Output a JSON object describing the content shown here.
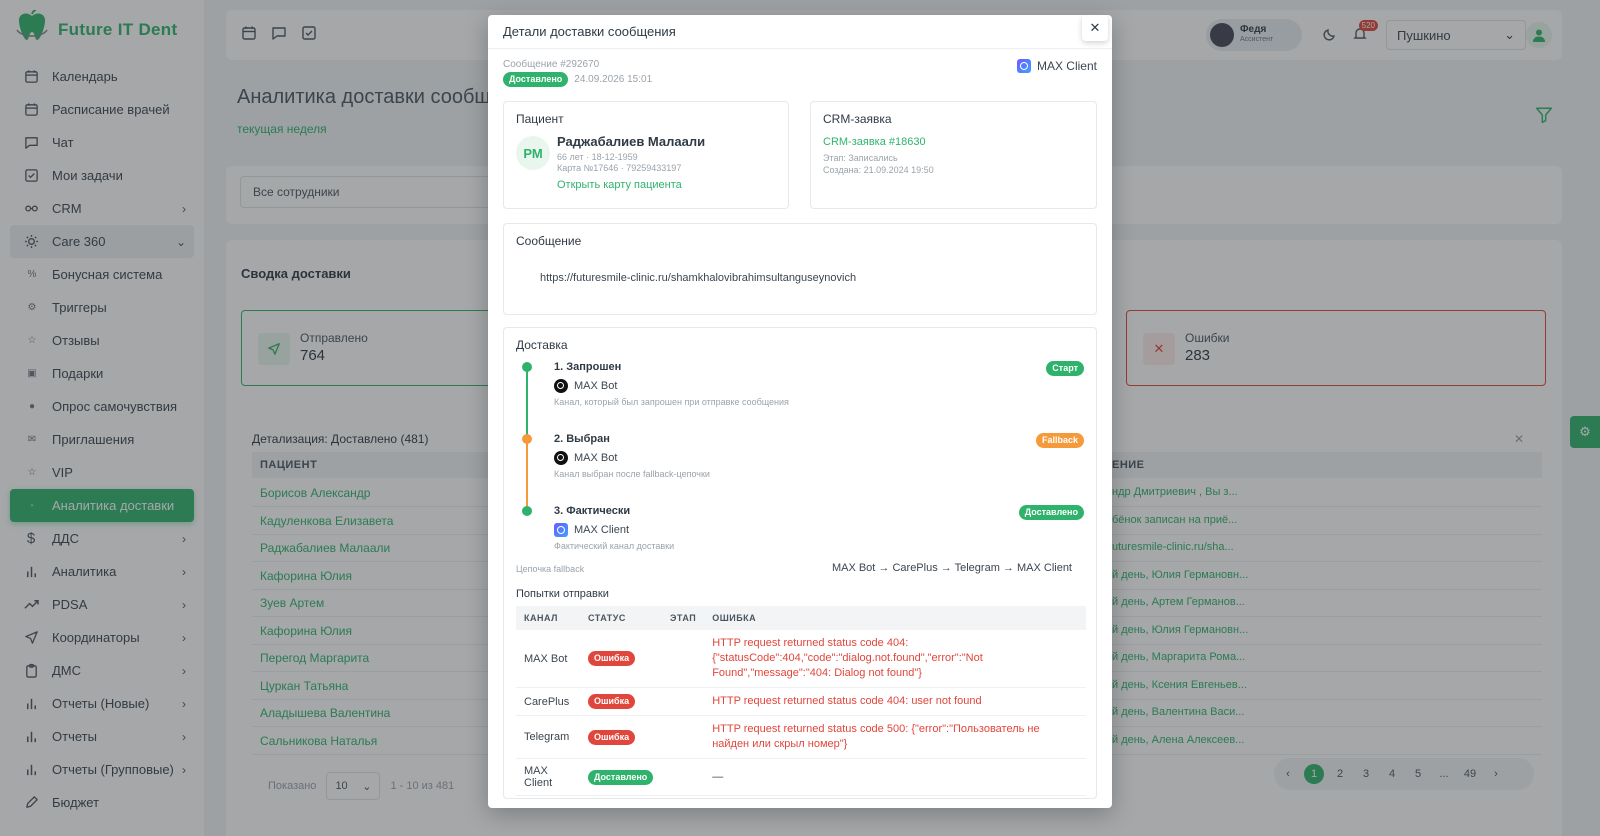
{
  "app": {
    "name": "Future IT Dent"
  },
  "sidebar": {
    "items": [
      {
        "label": "Календарь"
      },
      {
        "label": "Расписание врачей"
      },
      {
        "label": "Чат"
      },
      {
        "label": "Мои задачи"
      },
      {
        "label": "CRM"
      },
      {
        "label": "Care 360"
      },
      {
        "label": "Бонусная система"
      },
      {
        "label": "Триггеры"
      },
      {
        "label": "Отзывы"
      },
      {
        "label": "Подарки"
      },
      {
        "label": "Опрос самочувствия"
      },
      {
        "label": "Приглашения"
      },
      {
        "label": "VIP"
      },
      {
        "label": "Аналитика доставки"
      },
      {
        "label": "ДДС"
      },
      {
        "label": "Аналитика"
      },
      {
        "label": "PDSA"
      },
      {
        "label": "Координаторы"
      },
      {
        "label": "ДМС"
      },
      {
        "label": "Отчеты (Новые)"
      },
      {
        "label": "Отчеты"
      },
      {
        "label": "Отчеты (Групповые)"
      },
      {
        "label": "Бюджет"
      }
    ]
  },
  "topbar": {
    "assistant_name": "Федя",
    "assistant_role": "Ассистент",
    "notif_count": "520",
    "branch": "Пушкино"
  },
  "page": {
    "title": "Аналитика доставки сообщений",
    "period": "текущая неделя",
    "employee_filter": "Все сотрудники",
    "summary_title": "Сводка доставки",
    "sent_label": "Отправлено",
    "sent_value": "764",
    "errors_label": "Ошибки",
    "errors_value": "283",
    "detail_title": "Детализация: Доставлено (481)",
    "col_patient": "ПАЦИЕНТ",
    "col_message": "ЕНИЕ",
    "rows": [
      {
        "patient": "Борисов Александр",
        "msg": "ндр Дмитриевич , Вы з..."
      },
      {
        "patient": "Кадуленкова Елизавета",
        "msg": "бёнок записан на приё..."
      },
      {
        "patient": "Раджабалиев Малаали",
        "msg": "uturesmile-clinic.ru/sha..."
      },
      {
        "patient": "Кафорина Юлия",
        "msg": "й день, Юлия Германовн..."
      },
      {
        "patient": "Зуев Артем",
        "msg": "й день, Артем Германов..."
      },
      {
        "patient": "Кафорина Юлия",
        "msg": "й день, Юлия Германовн..."
      },
      {
        "patient": "Перегод Маргарита",
        "msg": "й день, Маргарита Рома..."
      },
      {
        "patient": "Цуркан Татьяна",
        "msg": "й день, Ксения Евгеньев..."
      },
      {
        "patient": "Аладышева Валентина",
        "msg": "й день, Валентина Васи..."
      },
      {
        "patient": "Сальникова Наталья",
        "msg": "й день, Алена Алексеев..."
      }
    ],
    "shown_label": "Показано",
    "per_page": "10",
    "range": "1 - 10 из 481",
    "pages": [
      "1",
      "2",
      "3",
      "4",
      "5",
      "...",
      "49"
    ]
  },
  "modal": {
    "title": "Детали доставки сообщения",
    "message_number": "Сообщение #292670",
    "status": "Доставлено",
    "date": "24.09.2026 15:01",
    "client": "MAX Client",
    "patient": {
      "title": "Пациент",
      "initials": "РМ",
      "name": "Раджабалиев Малаали",
      "age_line": "66 лет · 18-12-1959",
      "card_line": "Карта №17646 · 79259433197",
      "link": "Открыть карту пациента"
    },
    "crm": {
      "title": "CRM-заявка",
      "link": "CRM-заявка #18630",
      "stage": "Этап: Записались",
      "created": "Создана: 21.09.2024 19:50"
    },
    "message": {
      "title": "Сообщение",
      "text": "https://futuresmile-clinic.ru/shamkhalovibrahimsultanguseynovich"
    },
    "delivery": {
      "title": "Доставка",
      "steps": [
        {
          "title": "1. Запрошен",
          "channel": "MAX Bot",
          "desc": "Канал, который был запрошен при отправке сообщения",
          "badge": "Старт",
          "color": "#2fb36c"
        },
        {
          "title": "2. Выбран",
          "channel": "MAX Bot",
          "desc": "Канал выбран после fallback-цепочки",
          "badge": "Fallback",
          "color": "#f59a3a"
        },
        {
          "title": "3. Фактически",
          "channel": "MAX Client",
          "desc": "Фактический канал доставки",
          "badge": "Доставлено",
          "color": "#2fb36c"
        }
      ],
      "chain_label": "Цепочка fallback",
      "chain_value": "MAX Bot → CarePlus → Telegram → MAX Client",
      "attempts_title": "Попытки отправки",
      "headers": [
        "КАНАЛ",
        "СТАТУС",
        "ЭТАП",
        "ОШИБКА"
      ],
      "attempts": [
        {
          "channel": "MAX Bot",
          "status": "Ошибка",
          "status_type": "red",
          "stage": "",
          "error": "HTTP request returned status code 404: {\"statusCode\":404,\"code\":\"dialog.not.found\",\"error\":\"Not Found\",\"message\":\"404: Dialog not found\"}"
        },
        {
          "channel": "CarePlus",
          "status": "Ошибка",
          "status_type": "red",
          "stage": "",
          "error": "HTTP request returned status code 404: user not found"
        },
        {
          "channel": "Telegram",
          "status": "Ошибка",
          "status_type": "red",
          "stage": "",
          "error": "HTTP request returned status code 500: {\"error\":\"Пользователь не найден или скрыл номер\"}"
        },
        {
          "channel": "MAX Client",
          "status": "Доставлено",
          "status_type": "green",
          "stage": "",
          "error": "—"
        }
      ]
    }
  },
  "colors": {
    "accent": "#2fb36c",
    "error": "#e0463c",
    "warning": "#f59a3a"
  }
}
